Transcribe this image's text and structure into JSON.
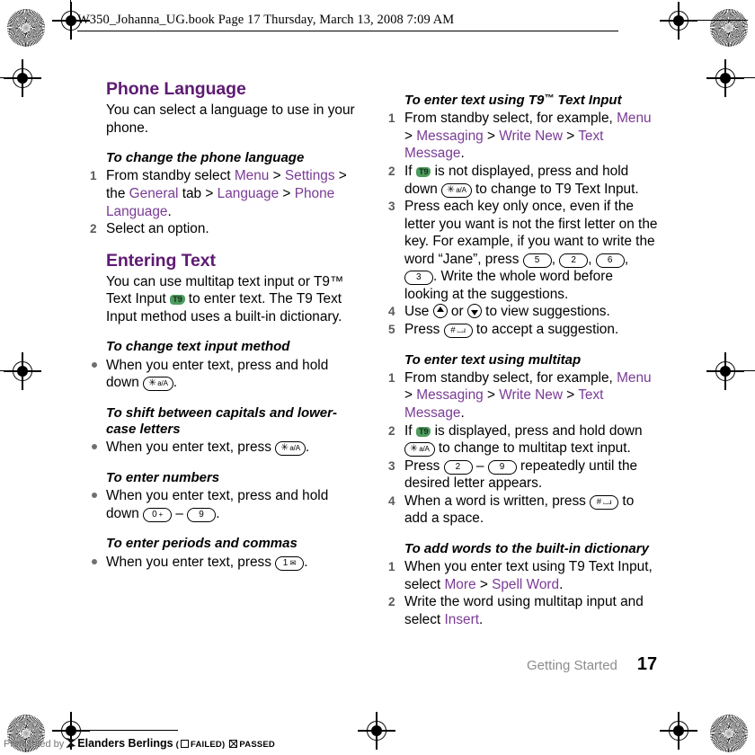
{
  "header": {
    "file_line": "W350_Johanna_UG.book  Page 17  Thursday, March 13, 2008  7:09 AM"
  },
  "colors": {
    "heading_purple": "#5e1a73",
    "link_purple": "#7a3b96",
    "t9_badge_green": "#4e9c5e",
    "footer_gray": "#8d8d8d",
    "marker_gray": "#5a5a5a"
  },
  "left_column": {
    "section1": {
      "heading": "Phone Language",
      "intro": "You can select a language to use in your phone.",
      "procedure": {
        "title": "To change the phone language",
        "steps": [
          {
            "num": "1",
            "parts": [
              {
                "t": "From standby select ",
                "k": "plain"
              },
              {
                "t": "Menu",
                "k": "link"
              },
              {
                "t": " > ",
                "k": "sep"
              },
              {
                "t": "Settings",
                "k": "link"
              },
              {
                "t": " > the ",
                "k": "plain"
              },
              {
                "t": "General",
                "k": "link"
              },
              {
                "t": " tab > ",
                "k": "plain"
              },
              {
                "t": "Language",
                "k": "link"
              },
              {
                "t": " > ",
                "k": "sep"
              },
              {
                "t": "Phone Language",
                "k": "link"
              },
              {
                "t": ".",
                "k": "plain"
              }
            ]
          },
          {
            "num": "2",
            "parts": [
              {
                "t": "Select an option.",
                "k": "plain"
              }
            ]
          }
        ]
      }
    },
    "section2": {
      "heading": "Entering Text",
      "intro_parts": [
        {
          "t": "You can use multitap text input or T9™ Text Input ",
          "k": "plain"
        },
        {
          "t": "T9",
          "k": "t9"
        },
        {
          "t": " to enter text. The T9 Text Input method uses a built-in dictionary.",
          "k": "plain"
        }
      ],
      "proc1": {
        "title": "To change text input method",
        "bullets": [
          {
            "parts": [
              {
                "t": "When you enter text, press and hold down ",
                "k": "plain"
              },
              {
                "t": "star-a-A",
                "k": "key"
              },
              {
                "t": ".",
                "k": "plain"
              }
            ]
          }
        ]
      },
      "proc2": {
        "title": "To shift between capitals and lower-case letters",
        "bullets": [
          {
            "parts": [
              {
                "t": "When you enter text, press ",
                "k": "plain"
              },
              {
                "t": "star-a-A",
                "k": "key"
              },
              {
                "t": ".",
                "k": "plain"
              }
            ]
          }
        ]
      },
      "proc3": {
        "title": "To enter numbers",
        "bullets": [
          {
            "parts": [
              {
                "t": "When you enter text, press and hold down ",
                "k": "plain"
              },
              {
                "t": "0-plus",
                "k": "key"
              },
              {
                "t": " – ",
                "k": "plain"
              },
              {
                "t": "9",
                "k": "key"
              },
              {
                "t": ".",
                "k": "plain"
              }
            ]
          }
        ]
      },
      "proc4": {
        "title": "To enter periods and commas",
        "bullets": [
          {
            "parts": [
              {
                "t": "When you enter text, press ",
                "k": "plain"
              },
              {
                "t": "1-envelope",
                "k": "key"
              },
              {
                "t": ".",
                "k": "plain"
              }
            ]
          }
        ]
      }
    }
  },
  "right_column": {
    "proc_t9": {
      "title_pre": "To enter text using T9",
      "title_tm": "™",
      "title_post": " Text Input",
      "steps": [
        {
          "num": "1",
          "parts": [
            {
              "t": "From standby select, for example, ",
              "k": "plain"
            },
            {
              "t": "Menu",
              "k": "link"
            },
            {
              "t": " > ",
              "k": "sep"
            },
            {
              "t": "Messaging",
              "k": "link"
            },
            {
              "t": " > ",
              "k": "sep"
            },
            {
              "t": "Write New",
              "k": "link"
            },
            {
              "t": " > ",
              "k": "sep"
            },
            {
              "t": "Text Message",
              "k": "link"
            },
            {
              "t": ".",
              "k": "plain"
            }
          ]
        },
        {
          "num": "2",
          "parts": [
            {
              "t": "If ",
              "k": "plain"
            },
            {
              "t": "T9",
              "k": "t9"
            },
            {
              "t": " is not displayed, press and hold down ",
              "k": "plain"
            },
            {
              "t": "star-a-A",
              "k": "key"
            },
            {
              "t": " to change to T9 Text Input.",
              "k": "plain"
            }
          ]
        },
        {
          "num": "3",
          "parts": [
            {
              "t": "Press each key only once, even if the letter you want is not the first letter on the key. For example, if you want to write the word “Jane”, press ",
              "k": "plain"
            },
            {
              "t": "5",
              "k": "key"
            },
            {
              "t": ", ",
              "k": "plain"
            },
            {
              "t": "2",
              "k": "key"
            },
            {
              "t": ", ",
              "k": "plain"
            },
            {
              "t": "6",
              "k": "key"
            },
            {
              "t": ", ",
              "k": "plain"
            },
            {
              "t": "3",
              "k": "key"
            },
            {
              "t": ". Write the whole word before looking at the suggestions.",
              "k": "plain"
            }
          ]
        },
        {
          "num": "4",
          "parts": [
            {
              "t": "Use ",
              "k": "plain"
            },
            {
              "t": "nav-up",
              "k": "nav"
            },
            {
              "t": " or ",
              "k": "plain"
            },
            {
              "t": "nav-down",
              "k": "nav"
            },
            {
              "t": " to view suggestions.",
              "k": "plain"
            }
          ]
        },
        {
          "num": "5",
          "parts": [
            {
              "t": "Press ",
              "k": "plain"
            },
            {
              "t": "hash-space",
              "k": "key"
            },
            {
              "t": " to accept a suggestion.",
              "k": "plain"
            }
          ]
        }
      ]
    },
    "proc_multitap": {
      "title": "To enter text using multitap",
      "steps": [
        {
          "num": "1",
          "parts": [
            {
              "t": "From standby select, for example, ",
              "k": "plain"
            },
            {
              "t": "Menu",
              "k": "link"
            },
            {
              "t": " > ",
              "k": "sep"
            },
            {
              "t": "Messaging",
              "k": "link"
            },
            {
              "t": " > ",
              "k": "sep"
            },
            {
              "t": "Write New",
              "k": "link"
            },
            {
              "t": " > ",
              "k": "sep"
            },
            {
              "t": "Text Message",
              "k": "link"
            },
            {
              "t": ".",
              "k": "plain"
            }
          ]
        },
        {
          "num": "2",
          "parts": [
            {
              "t": "If ",
              "k": "plain"
            },
            {
              "t": "T9",
              "k": "t9"
            },
            {
              "t": " is displayed, press and hold down ",
              "k": "plain"
            },
            {
              "t": "star-a-A",
              "k": "key"
            },
            {
              "t": " to change to multitap text input.",
              "k": "plain"
            }
          ]
        },
        {
          "num": "3",
          "parts": [
            {
              "t": "Press ",
              "k": "plain"
            },
            {
              "t": "2",
              "k": "key"
            },
            {
              "t": " – ",
              "k": "plain"
            },
            {
              "t": "9",
              "k": "key"
            },
            {
              "t": " repeatedly until the desired letter appears.",
              "k": "plain"
            }
          ]
        },
        {
          "num": "4",
          "parts": [
            {
              "t": "When a word is written, press ",
              "k": "plain"
            },
            {
              "t": "hash-space",
              "k": "key"
            },
            {
              "t": " to add a space.",
              "k": "plain"
            }
          ]
        }
      ]
    },
    "proc_dictionary": {
      "title": "To add words to the built-in dictionary",
      "steps": [
        {
          "num": "1",
          "parts": [
            {
              "t": "When you enter text using T9 Text Input, select ",
              "k": "plain"
            },
            {
              "t": "More",
              "k": "link"
            },
            {
              "t": " > ",
              "k": "sep"
            },
            {
              "t": "Spell Word",
              "k": "link"
            },
            {
              "t": ".",
              "k": "plain"
            }
          ]
        },
        {
          "num": "2",
          "parts": [
            {
              "t": "Write the word using multitap input and select ",
              "k": "plain"
            },
            {
              "t": "Insert",
              "k": "link"
            },
            {
              "t": ".",
              "k": "plain"
            }
          ]
        }
      ]
    }
  },
  "footer": {
    "section_name": "Getting Started",
    "page_number": "17"
  },
  "preflight": {
    "prefix": "Preflighted by",
    "brand": "Elanders Berlings",
    "open_paren": "(",
    "failed_label": "FAILED",
    "close_paren": ")",
    "passed_label": "PASSED"
  },
  "keycaps": {
    "star-a-A": {
      "main": "✳",
      "sub": "a/A"
    },
    "0-plus": {
      "main": "0",
      "sub": "+"
    },
    "1-envelope": {
      "main": "1",
      "sub": "✉"
    },
    "2": {
      "main": "2",
      "sub": ""
    },
    "3": {
      "main": "3",
      "sub": ""
    },
    "5": {
      "main": "5",
      "sub": ""
    },
    "6": {
      "main": "6",
      "sub": ""
    },
    "9": {
      "main": "9",
      "sub": ""
    },
    "hash-space": {
      "main": "#",
      "sub": "⌴ɹ"
    }
  }
}
